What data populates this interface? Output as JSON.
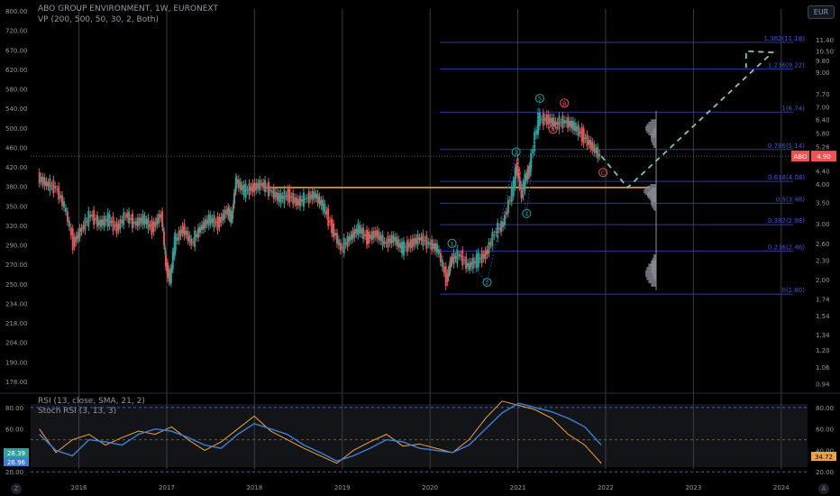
{
  "header": {
    "title": "ABO GROUP ENVIRONMENT, 1W, EURONEXT",
    "vp_label": "VP (200, 500, 50, 30, 2, Both)",
    "rsi_label": "RSI (13, close, SMA, 21, 2)",
    "stoch_label": "Stoch RSI (3, 13, 3)"
  },
  "buttons": {
    "currency": "EUR",
    "left_corner": "Z",
    "right_corner": "A"
  },
  "colors": {
    "background": "#000000",
    "up": "#26a69a",
    "down": "#ef5350",
    "fib": "#2a3a9c",
    "fib_text": "#3d56d8",
    "gold": "#e8a33a",
    "projection": "#7fc8b8",
    "rsi": "#f2a23a",
    "stoch": "#3d7fd6",
    "price_tag": "#ef5350",
    "rsi_tag_a": "#26a69a",
    "rsi_tag_b": "#3d7fd6"
  },
  "chart_data": [
    {
      "type": "candlestick",
      "title": "ABO GROUP ENVIRONMENT, 1W, EURONEXT",
      "x_ticks": [
        "2016",
        "2017",
        "2018",
        "2019",
        "2020",
        "2021",
        "2022",
        "2023",
        "2024"
      ],
      "left_axis_ticks": [
        "800.00",
        "720.00",
        "670.00",
        "620.00",
        "580.00",
        "540.00",
        "500.00",
        "460.00",
        "420.00",
        "380.00",
        "350.00",
        "320.00",
        "290.00",
        "270.00",
        "250.00",
        "234.00",
        "218.00",
        "204.00",
        "190.00",
        "178.00"
      ],
      "right_axis_ticks": [
        "11.40",
        "10.50",
        "9.80",
        "9.00",
        "7.70",
        "7.00",
        "6.40",
        "5.80",
        "5.26",
        "4.40",
        "4.00",
        "3.50",
        "3.00",
        "2.60",
        "2.30",
        "2.00",
        "1.74",
        "1.54",
        "1.34",
        "1.20",
        "1.06",
        "0.94"
      ],
      "price_scale": "log",
      "y_range": [
        0.9,
        12.5
      ],
      "last_price": {
        "label": "ABO",
        "value": "4.90"
      },
      "current_price_marker": "460.00",
      "weekly_close_series": [
        {
          "t": 2015.55,
          "c": 4.2
        },
        {
          "t": 2015.65,
          "c": 4.0
        },
        {
          "t": 2015.75,
          "c": 3.9
        },
        {
          "t": 2015.85,
          "c": 3.4
        },
        {
          "t": 2015.95,
          "c": 2.6
        },
        {
          "t": 2016.05,
          "c": 2.9
        },
        {
          "t": 2016.15,
          "c": 3.2
        },
        {
          "t": 2016.25,
          "c": 3.0
        },
        {
          "t": 2016.35,
          "c": 3.1
        },
        {
          "t": 2016.45,
          "c": 2.9
        },
        {
          "t": 2016.55,
          "c": 3.2
        },
        {
          "t": 2016.65,
          "c": 3.0
        },
        {
          "t": 2016.75,
          "c": 3.1
        },
        {
          "t": 2016.85,
          "c": 2.9
        },
        {
          "t": 2016.95,
          "c": 3.2
        },
        {
          "t": 2017.0,
          "c": 2.2
        },
        {
          "t": 2017.05,
          "c": 2.0
        },
        {
          "t": 2017.1,
          "c": 2.6
        },
        {
          "t": 2017.2,
          "c": 2.9
        },
        {
          "t": 2017.3,
          "c": 2.6
        },
        {
          "t": 2017.4,
          "c": 2.9
        },
        {
          "t": 2017.5,
          "c": 3.1
        },
        {
          "t": 2017.6,
          "c": 3.0
        },
        {
          "t": 2017.7,
          "c": 3.3
        },
        {
          "t": 2017.75,
          "c": 3.1
        },
        {
          "t": 2017.8,
          "c": 4.1
        },
        {
          "t": 2017.9,
          "c": 3.8
        },
        {
          "t": 2018.0,
          "c": 3.9
        },
        {
          "t": 2018.1,
          "c": 4.0
        },
        {
          "t": 2018.2,
          "c": 3.8
        },
        {
          "t": 2018.3,
          "c": 3.6
        },
        {
          "t": 2018.4,
          "c": 3.7
        },
        {
          "t": 2018.5,
          "c": 3.5
        },
        {
          "t": 2018.6,
          "c": 3.6
        },
        {
          "t": 2018.7,
          "c": 3.7
        },
        {
          "t": 2018.8,
          "c": 3.4
        },
        {
          "t": 2018.9,
          "c": 2.9
        },
        {
          "t": 2019.0,
          "c": 2.5
        },
        {
          "t": 2019.1,
          "c": 2.7
        },
        {
          "t": 2019.2,
          "c": 2.9
        },
        {
          "t": 2019.3,
          "c": 2.7
        },
        {
          "t": 2019.4,
          "c": 2.8
        },
        {
          "t": 2019.5,
          "c": 2.6
        },
        {
          "t": 2019.6,
          "c": 2.7
        },
        {
          "t": 2019.7,
          "c": 2.5
        },
        {
          "t": 2019.8,
          "c": 2.6
        },
        {
          "t": 2019.9,
          "c": 2.7
        },
        {
          "t": 2020.0,
          "c": 2.6
        },
        {
          "t": 2020.1,
          "c": 2.5
        },
        {
          "t": 2020.2,
          "c": 2.0
        },
        {
          "t": 2020.25,
          "c": 2.3
        },
        {
          "t": 2020.35,
          "c": 2.4
        },
        {
          "t": 2020.45,
          "c": 2.2
        },
        {
          "t": 2020.55,
          "c": 2.3
        },
        {
          "t": 2020.65,
          "c": 2.4
        },
        {
          "t": 2020.75,
          "c": 2.8
        },
        {
          "t": 2020.85,
          "c": 3.0
        },
        {
          "t": 2020.95,
          "c": 3.8
        },
        {
          "t": 2021.0,
          "c": 4.6
        },
        {
          "t": 2021.05,
          "c": 3.7
        },
        {
          "t": 2021.1,
          "c": 4.2
        },
        {
          "t": 2021.15,
          "c": 4.5
        },
        {
          "t": 2021.25,
          "c": 6.4
        },
        {
          "t": 2021.35,
          "c": 6.4
        },
        {
          "t": 2021.45,
          "c": 6.2
        },
        {
          "t": 2021.55,
          "c": 6.3
        },
        {
          "t": 2021.65,
          "c": 6.1
        },
        {
          "t": 2021.75,
          "c": 5.7
        },
        {
          "t": 2021.85,
          "c": 5.3
        },
        {
          "t": 2021.95,
          "c": 4.9
        }
      ]
    },
    {
      "type": "fibonacci",
      "levels": [
        {
          "ratio": "1.382",
          "price": "11.18",
          "value": 11.18
        },
        {
          "ratio": "1.236",
          "price": "9.22",
          "value": 9.22
        },
        {
          "ratio": "1",
          "price": "6.74",
          "value": 6.74
        },
        {
          "ratio": "0.786",
          "price": "5.14",
          "value": 5.14
        },
        {
          "ratio": "0.618",
          "price": "4.08",
          "value": 4.08
        },
        {
          "ratio": "0.5",
          "price": "3.48",
          "value": 3.48
        },
        {
          "ratio": "0.382",
          "price": "2.98",
          "value": 2.98
        },
        {
          "ratio": "0.236",
          "price": "2.46",
          "value": 2.46
        },
        {
          "ratio": "0",
          "price": "1.80",
          "value": 1.8
        }
      ],
      "support_line": {
        "price": 3.9,
        "from": 2018.1,
        "to": 2022.5
      },
      "wave_labels": [
        {
          "text": "1",
          "t": 2020.25,
          "p": 2.6,
          "color": "teal"
        },
        {
          "text": "2",
          "t": 2020.65,
          "p": 1.96,
          "color": "teal"
        },
        {
          "text": "3",
          "t": 2020.98,
          "p": 5.05,
          "color": "teal"
        },
        {
          "text": "4",
          "t": 2021.1,
          "p": 3.23,
          "color": "teal"
        },
        {
          "text": "5",
          "t": 2021.25,
          "p": 7.45,
          "color": "teal"
        },
        {
          "text": "A",
          "t": 2021.4,
          "p": 5.95,
          "color": "red"
        },
        {
          "text": "B",
          "t": 2021.53,
          "p": 7.2,
          "color": "red"
        },
        {
          "text": "C",
          "t": 2021.97,
          "p": 4.35,
          "color": "red"
        }
      ],
      "projection_path": [
        {
          "t": 2021.95,
          "p": 4.9
        },
        {
          "t": 2022.25,
          "p": 3.9
        },
        {
          "t": 2023.9,
          "p": 10.4
        },
        {
          "t": 2023.6,
          "p": 10.5
        },
        {
          "t": 2023.6,
          "p": 9.3
        }
      ]
    },
    {
      "type": "line",
      "title": "RSI (13, close, SMA, 21, 2)",
      "ylim": [
        16,
        90
      ],
      "y_ticks": [
        "80.00",
        "60.00",
        "40.00",
        "20.00"
      ],
      "right_ticks": [
        "80.00",
        "60.00",
        "40.00",
        "20.00"
      ],
      "bands": {
        "upper": 80,
        "middle": 50,
        "lower": 20
      },
      "last_values": {
        "rsi": "28.39",
        "stoch": "26.96",
        "right": "34.72"
      },
      "series": [
        {
          "name": "RSI",
          "values": [
            60,
            38,
            50,
            55,
            45,
            52,
            58,
            55,
            62,
            50,
            40,
            48,
            60,
            72,
            58,
            50,
            42,
            35,
            28,
            40,
            48,
            55,
            44,
            46,
            42,
            38,
            50,
            70,
            86,
            82,
            78,
            70,
            55,
            45,
            28
          ]
        },
        {
          "name": "Stoch RSI",
          "values": [
            55,
            40,
            35,
            50,
            48,
            45,
            55,
            60,
            58,
            52,
            45,
            42,
            55,
            65,
            60,
            55,
            45,
            38,
            30,
            35,
            42,
            50,
            48,
            42,
            40,
            38,
            45,
            60,
            75,
            84,
            80,
            76,
            70,
            62,
            45
          ]
        }
      ],
      "t_start": 2015.55,
      "t_end": 2021.95
    }
  ]
}
